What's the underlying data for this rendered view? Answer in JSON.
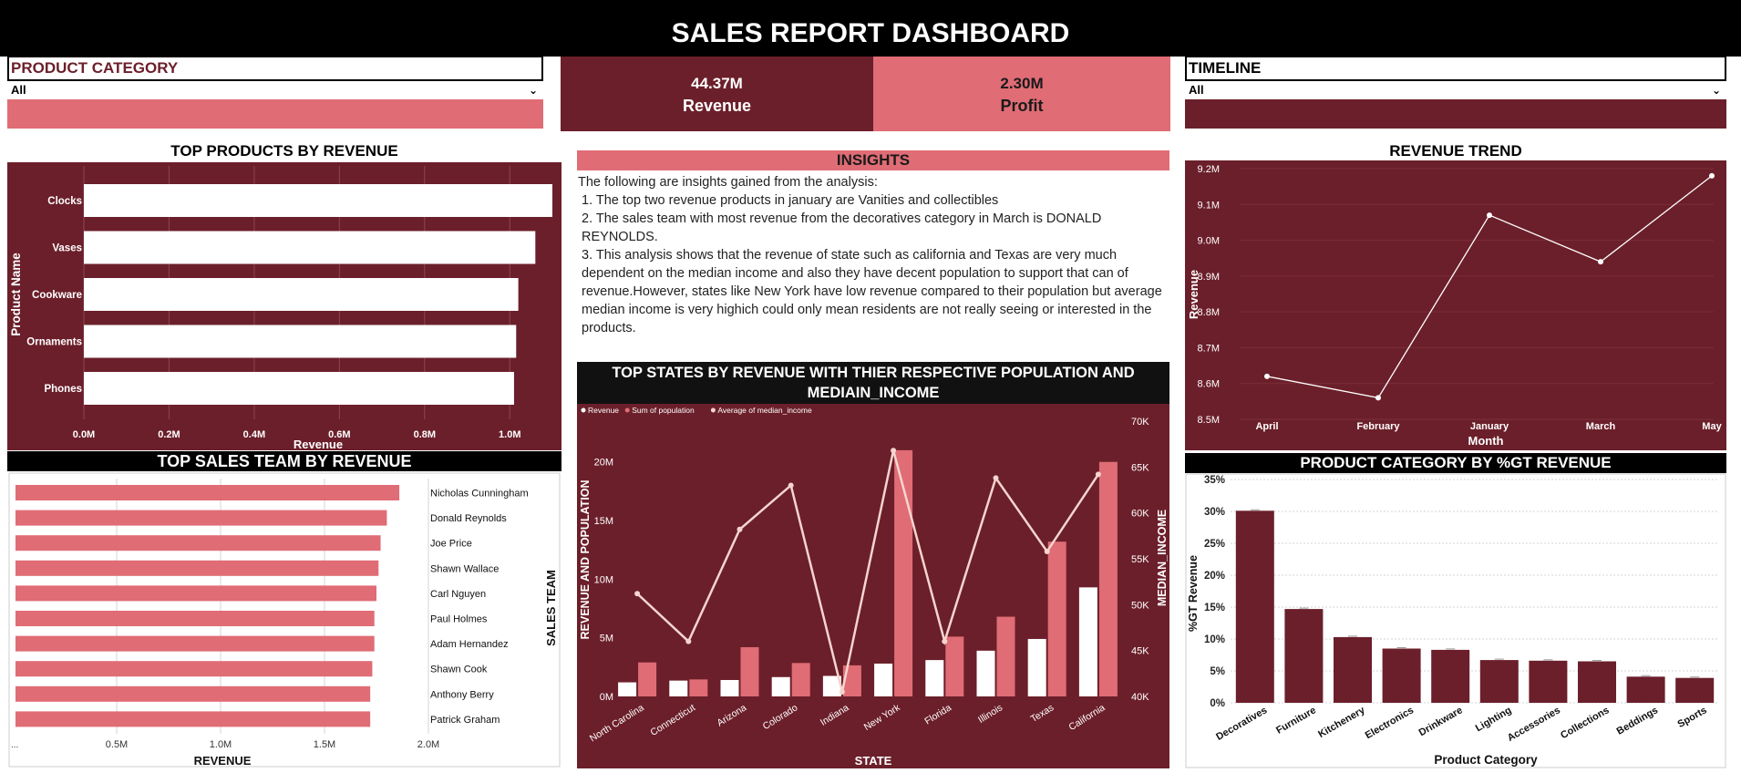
{
  "header": {
    "title": "SALES REPORT DASHBOARD"
  },
  "slicers": {
    "category": {
      "title": "PRODUCT CATEGORY",
      "value": "All"
    },
    "timeline": {
      "title": "TIMELINE",
      "value": "All"
    }
  },
  "kpis": {
    "revenue": {
      "value": "44.37M",
      "label": "Revenue"
    },
    "profit": {
      "value": "2.30M",
      "label": "Profit"
    }
  },
  "insights": {
    "title": "INSIGHTS",
    "intro": "The following are insights gained from the analysis:",
    "point1": "1. The top two revenue products  in  january are Vanities and collectibles",
    "point2": "2. The sales team with most revenue from the decoratives category in March is DONALD REYNOLDS.",
    "point3": "3. This analysis shows that the revenue of state such as california  and  Texas are very much dependent on the median income and also they have decent population to support that can of revenue.However, states like  New York  have low revenue compared to their population but average median income is very highich could only mean residents are not really seeing or interested in the products."
  },
  "colors": {
    "maroon": "#6b1f2a",
    "pink": "#e06c75",
    "white": "#ffffff",
    "black": "#000000",
    "line": "#f5d5cf"
  },
  "chart_data": [
    {
      "id": "top-products",
      "type": "bar",
      "orientation": "horizontal",
      "title": "TOP PRODUCTS BY REVENUE",
      "xlabel": "Revenue",
      "ylabel": "Product Name",
      "categories": [
        "Clocks",
        "Vases",
        "Cookware",
        "Ornaments",
        "Phones"
      ],
      "values": [
        1.1,
        1.06,
        1.02,
        1.015,
        1.01
      ],
      "xticks": [
        "0.0M",
        "0.2M",
        "0.4M",
        "0.6M",
        "0.8M",
        "1.0M"
      ],
      "xlim": [
        0,
        1.1
      ],
      "grid": true
    },
    {
      "id": "top-sales-team",
      "type": "bar",
      "orientation": "horizontal",
      "title": "TOP SALES TEAM BY REVENUE",
      "xlabel": "REVENUE",
      "ylabel": "SALES TEAM",
      "categories": [
        "Nicholas Cunningham",
        "Donald Reynolds",
        "Joe Price",
        "Shawn Wallace",
        "Carl Nguyen",
        "Paul Holmes",
        "Adam Hernandez",
        "Shawn Cook",
        "Anthony Berry",
        "Patrick Graham"
      ],
      "values": [
        1.86,
        1.8,
        1.77,
        1.76,
        1.75,
        1.74,
        1.74,
        1.73,
        1.72,
        1.72
      ],
      "xticks": [
        "0.5M",
        "1.0M",
        "1.5M",
        "2.0M"
      ],
      "xstart_label": "...",
      "xlim": [
        0,
        2.0
      ],
      "grid": true
    },
    {
      "id": "top-states",
      "type": "bar",
      "title": "TOP STATES BY REVENUE WITH THIER RESPECTIVE POPULATION AND MEDIAIN_INCOME",
      "xlabel": "STATE",
      "ylabel": "REVENUE AND POPULATION",
      "y2label": "MEDIAN_INCOME",
      "legend": [
        "Revenue",
        "Sum of population",
        "Average of median_income"
      ],
      "categories": [
        "North Carolina",
        "Connecticut",
        "Arizona",
        "Colorado",
        "Indiana",
        "New York",
        "Florida",
        "Illinois",
        "Texas",
        "California"
      ],
      "series": [
        {
          "name": "Revenue",
          "kind": "bar",
          "values": [
            1.2,
            1.35,
            1.4,
            1.65,
            1.75,
            2.8,
            3.1,
            3.9,
            4.9,
            9.3
          ]
        },
        {
          "name": "Sum of population",
          "kind": "bar",
          "values": [
            2.9,
            1.45,
            4.2,
            2.85,
            2.65,
            21.0,
            5.1,
            6.8,
            13.2,
            20.0
          ]
        },
        {
          "name": "Average of median_income",
          "kind": "line",
          "axis": "right",
          "values": [
            51.2,
            46.0,
            58.2,
            63.0,
            40.5,
            66.8,
            46.0,
            63.8,
            55.8,
            64.2
          ]
        }
      ],
      "yticks": [
        "0M",
        "5M",
        "10M",
        "15M",
        "20M"
      ],
      "ylim": [
        0,
        22
      ],
      "y2ticks": [
        "40K",
        "45K",
        "50K",
        "55K",
        "60K",
        "65K",
        "70K"
      ],
      "y2lim": [
        40,
        70
      ]
    },
    {
      "id": "revenue-trend",
      "type": "line",
      "title": "REVENUE TREND",
      "xlabel": "Month",
      "ylabel": "Revenue",
      "categories": [
        "April",
        "February",
        "January",
        "March",
        "May"
      ],
      "values": [
        8.62,
        8.56,
        9.07,
        8.94,
        9.18
      ],
      "yticks": [
        "8.5M",
        "8.6M",
        "8.7M",
        "8.8M",
        "8.9M",
        "9.0M",
        "9.1M",
        "9.2M"
      ],
      "ylim": [
        8.5,
        9.2
      ]
    },
    {
      "id": "category-pct",
      "type": "bar",
      "title": "PRODUCT CATEGORY BY %GT REVENUE",
      "xlabel": "Product Category",
      "ylabel": "%GT Revenue",
      "categories": [
        "Decoratives",
        "Furniture",
        "Kitchenery",
        "Electronics",
        "Drinkware",
        "Lighting",
        "Accessories",
        "Collections",
        "Beddings",
        "Sports"
      ],
      "values": [
        30.1,
        14.7,
        10.3,
        8.5,
        8.3,
        6.7,
        6.6,
        6.5,
        4.1,
        3.9
      ],
      "yticks": [
        "0%",
        "5%",
        "10%",
        "15%",
        "20%",
        "25%",
        "30%",
        "35%"
      ],
      "ylim": [
        0,
        35
      ]
    }
  ]
}
